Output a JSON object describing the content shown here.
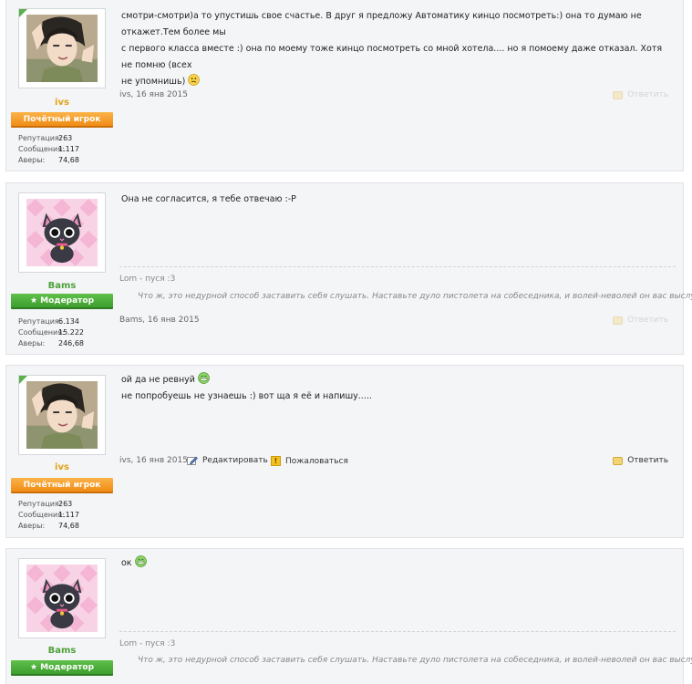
{
  "posts": [
    {
      "author": "ivs",
      "rank": "Почётный игрок",
      "stats": [
        {
          "label": "Репутация:",
          "value": "263"
        },
        {
          "label": "Сообщения:",
          "value": "1.117"
        },
        {
          "label": "Аверы:",
          "value": "74,68"
        }
      ],
      "text_lines": [
        "смотри-смотри)а то упустишь свое счастье. В друг я предложу Автоматику кинцо посмотреть:) она то думаю не откажет.Тем более мы",
        "с первого класса вместе :) она по моему тоже кинцо посмотреть со мной хотела.... но я помоему даже отказал. Хотя не помню (всех",
        "не упомнишь)"
      ],
      "date": "ivs, 16 янв 2015",
      "reply_label": "Ответить"
    },
    {
      "author": "Bams",
      "rank": "★ Модератор",
      "stats": [
        {
          "label": "Репутация:",
          "value": "6.134"
        },
        {
          "label": "Сообщения:",
          "value": "15.222"
        },
        {
          "label": "Аверы:",
          "value": "246,68"
        }
      ],
      "text_lines": [
        "Она не согласится, я тебе отвечаю :-P"
      ],
      "signature_name": "Lom - пуся :3",
      "signature_quote": "Что ж, это недурной способ заставить себя слушать. Наставьте дуло пистолета на собеседника, и волей-неволей он вас выслушает.",
      "date": "Bams, 16 янв 2015",
      "reply_label": "Ответить"
    },
    {
      "author": "ivs",
      "rank": "Почётный игрок",
      "stats": [
        {
          "label": "Репутация:",
          "value": "263"
        },
        {
          "label": "Сообщения:",
          "value": "1.117"
        },
        {
          "label": "Аверы:",
          "value": "74,68"
        }
      ],
      "text_lines": [
        "ой да не ревнуй",
        "не попробуешь не узнаешь :) вот ща я её и напишу....."
      ],
      "date": "ivs, 16 янв 2015",
      "edit_label": "Редактировать",
      "report_label": "Пожаловаться",
      "reply_label": "Ответить"
    },
    {
      "author": "Bams",
      "rank": "★ Модератор",
      "text_lines": [
        "ок"
      ],
      "signature_name": "Lom - пуся :3",
      "signature_quote": "Что ж, это недурной способ заставить себя слушать. Наставьте дуло пистолета на собеседника, и волей-неволей он вас выслушает."
    }
  ]
}
